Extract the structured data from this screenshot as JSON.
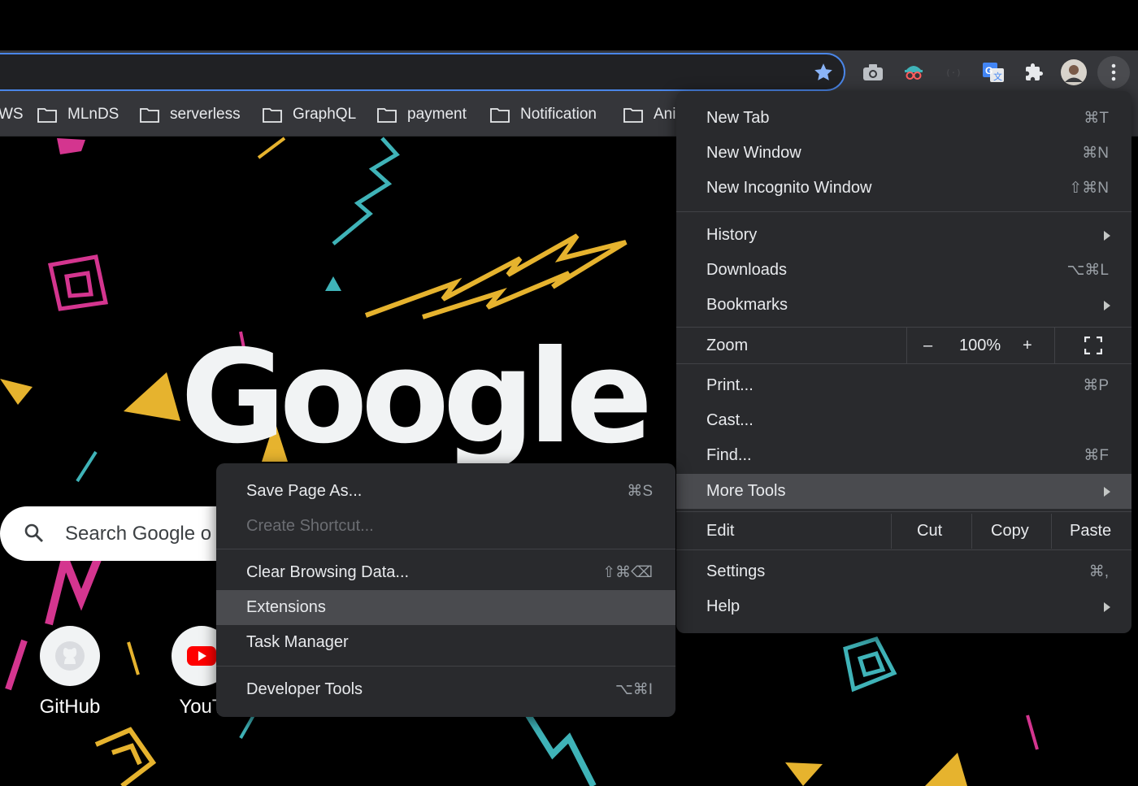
{
  "toolbar": {
    "icons": [
      "bookmark-star-icon",
      "camera-icon",
      "spy-extension-icon",
      "placeholder-extension-icon",
      "google-translate-icon",
      "puzzle-icon",
      "profile-avatar",
      "kebab-menu-icon"
    ]
  },
  "bookmarks": {
    "items": [
      {
        "label": "WS"
      },
      {
        "label": "MLnDS"
      },
      {
        "label": "serverless"
      },
      {
        "label": "GraphQL"
      },
      {
        "label": "payment"
      },
      {
        "label": "Notification"
      },
      {
        "label": "Ani"
      }
    ]
  },
  "ntp": {
    "logo": "Google",
    "search_placeholder": "Search Google o",
    "shortcuts": [
      {
        "label": "GitHub",
        "icon": "github-icon"
      },
      {
        "label": "YouT",
        "icon": "youtube-icon"
      }
    ]
  },
  "main_menu": {
    "new_tab": {
      "label": "New Tab",
      "shortcut": "⌘T"
    },
    "new_window": {
      "label": "New Window",
      "shortcut": "⌘N"
    },
    "new_incognito": {
      "label": "New Incognito Window",
      "shortcut": "⇧⌘N"
    },
    "history": {
      "label": "History"
    },
    "downloads": {
      "label": "Downloads",
      "shortcut": "⌥⌘L"
    },
    "bookmarks": {
      "label": "Bookmarks"
    },
    "zoom": {
      "label": "Zoom",
      "minus": "–",
      "value": "100%",
      "plus": "+"
    },
    "print": {
      "label": "Print...",
      "shortcut": "⌘P"
    },
    "cast": {
      "label": "Cast..."
    },
    "find": {
      "label": "Find...",
      "shortcut": "⌘F"
    },
    "more_tools": {
      "label": "More Tools"
    },
    "edit": {
      "label": "Edit",
      "cut": "Cut",
      "copy": "Copy",
      "paste": "Paste"
    },
    "settings": {
      "label": "Settings",
      "shortcut": "⌘,"
    },
    "help": {
      "label": "Help"
    }
  },
  "sub_menu": {
    "save_page": {
      "label": "Save Page As...",
      "shortcut": "⌘S"
    },
    "create_shortcut": {
      "label": "Create Shortcut..."
    },
    "clear_browsing": {
      "label": "Clear Browsing Data...",
      "shortcut": "⇧⌘⌫"
    },
    "extensions": {
      "label": "Extensions"
    },
    "task_manager": {
      "label": "Task Manager"
    },
    "developer_tools": {
      "label": "Developer Tools",
      "shortcut": "⌥⌘I"
    }
  },
  "colors": {
    "accent_blue": "#4a86e8",
    "menu_bg": "#292a2d",
    "highlight": "#4a4b4f",
    "deco_pink": "#d4358f",
    "deco_teal": "#3fb3b8",
    "deco_yellow": "#e6b32e"
  }
}
